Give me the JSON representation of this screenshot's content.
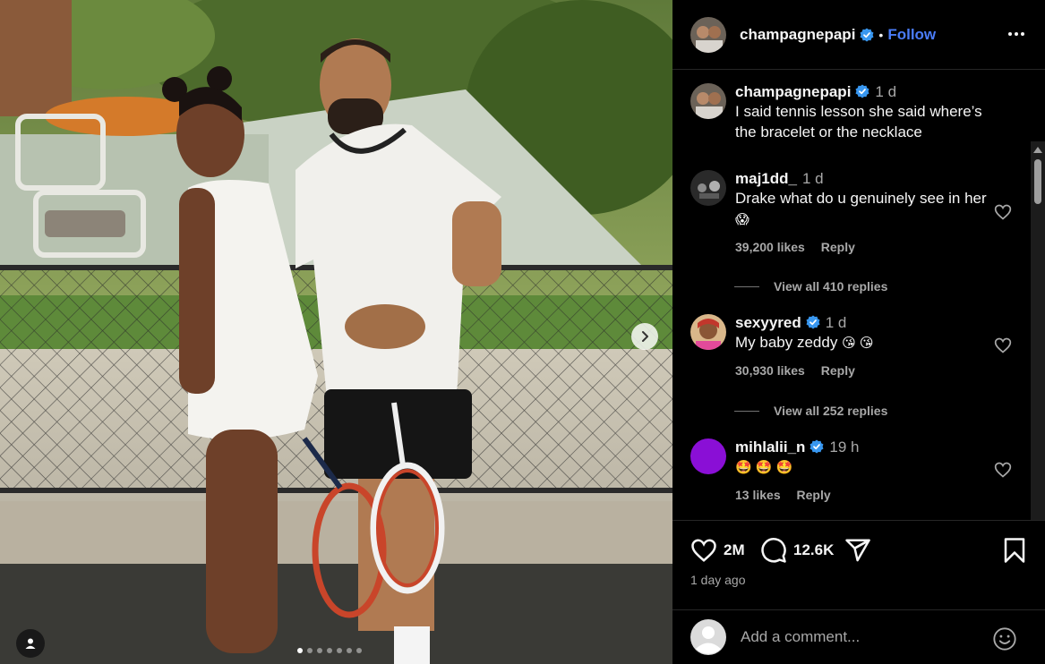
{
  "post": {
    "author": "champagnepapi",
    "follow_label": "Follow",
    "separator": "•",
    "carousel_count": 7,
    "carousel_active": 0
  },
  "comments": [
    {
      "user": "champagnepapi",
      "verified": true,
      "time": "1 d",
      "text": "I said tennis lesson she said where’s the bracelet or the necklace",
      "is_caption": true
    },
    {
      "user": "maj1dd_",
      "verified": false,
      "time": "1 d",
      "text": "Drake what do u genuinely see in her",
      "emoji": "😱",
      "likes": "39,200 likes",
      "reply": "Reply",
      "view_replies": "View all 410 replies"
    },
    {
      "user": "sexyyred",
      "verified": true,
      "time": "1 d",
      "text": "My baby zeddy",
      "emoji": "😘 😘",
      "likes": "30,930 likes",
      "reply": "Reply",
      "view_replies": "View all 252 replies"
    },
    {
      "user": "mihlalii_n",
      "verified": true,
      "time": "19 h",
      "text": "",
      "emoji": "🤩 🤩 🤩",
      "likes": "13 likes",
      "reply": "Reply"
    }
  ],
  "actions": {
    "like_count": "2M",
    "comment_count": "12.6K",
    "date": "1 day ago"
  },
  "add_comment": {
    "placeholder": "Add a comment..."
  },
  "icons": {
    "more": "more-icon",
    "heart": "heart-icon",
    "comment": "comment-icon",
    "share": "share-icon",
    "save": "bookmark-icon",
    "emoji": "emoji-icon",
    "next": "chevron-right-icon",
    "tag": "user-tag-icon"
  },
  "colors": {
    "accent": "#4a7cf8",
    "verified": "#3897f0",
    "background": "#000000",
    "muted": "#a8a8a8"
  }
}
